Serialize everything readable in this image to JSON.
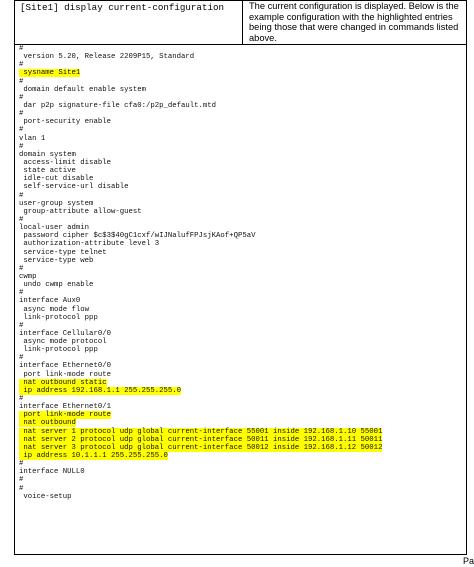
{
  "header": {
    "command": "[Site1] display current-configuration",
    "description": "The current configuration is displayed. Below is the example configuration with the highlighted entries being those that were changed in commands listed above."
  },
  "config_lines": [
    {
      "text": "#",
      "hl": false
    },
    {
      "text": " version 5.20, Release 2209P15, Standard",
      "hl": false
    },
    {
      "text": "#",
      "hl": false
    },
    {
      "text": " sysname Site1",
      "hl": true
    },
    {
      "text": "#",
      "hl": false
    },
    {
      "text": " domain default enable system",
      "hl": false
    },
    {
      "text": "#",
      "hl": false
    },
    {
      "text": " dar p2p signature-file cfa0:/p2p_default.mtd",
      "hl": false
    },
    {
      "text": "#",
      "hl": false
    },
    {
      "text": " port-security enable",
      "hl": false
    },
    {
      "text": "#",
      "hl": false
    },
    {
      "text": "vlan 1",
      "hl": false
    },
    {
      "text": "#",
      "hl": false
    },
    {
      "text": "domain system",
      "hl": false
    },
    {
      "text": " access-limit disable",
      "hl": false
    },
    {
      "text": " state active",
      "hl": false
    },
    {
      "text": " idle-cut disable",
      "hl": false
    },
    {
      "text": " self-service-url disable",
      "hl": false
    },
    {
      "text": "#",
      "hl": false
    },
    {
      "text": "user-group system",
      "hl": false
    },
    {
      "text": " group-attribute allow-guest",
      "hl": false
    },
    {
      "text": "#",
      "hl": false
    },
    {
      "text": "local-user admin",
      "hl": false
    },
    {
      "text": " password cipher $c$3$40gC1cxf/wIJNalufFPJsjKAof+QP5aV",
      "hl": false
    },
    {
      "text": " authorization-attribute level 3",
      "hl": false
    },
    {
      "text": " service-type telnet",
      "hl": false
    },
    {
      "text": " service-type web",
      "hl": false
    },
    {
      "text": "#",
      "hl": false
    },
    {
      "text": "cwmp",
      "hl": false
    },
    {
      "text": " undo cwmp enable",
      "hl": false
    },
    {
      "text": "#",
      "hl": false
    },
    {
      "text": "interface Aux0",
      "hl": false
    },
    {
      "text": " async mode flow",
      "hl": false
    },
    {
      "text": " link-protocol ppp",
      "hl": false
    },
    {
      "text": "#",
      "hl": false
    },
    {
      "text": "interface Cellular0/0",
      "hl": false
    },
    {
      "text": " async mode protocol",
      "hl": false
    },
    {
      "text": " link-protocol ppp",
      "hl": false
    },
    {
      "text": "#",
      "hl": false
    },
    {
      "text": "interface Ethernet0/0",
      "hl": false
    },
    {
      "text": " port link-mode route",
      "hl": false
    },
    {
      "text": " nat outbound static",
      "hl": true
    },
    {
      "text": " ip address 192.168.1.1 255.255.255.0",
      "hl": true
    },
    {
      "text": "#",
      "hl": false
    },
    {
      "text": "interface Ethernet0/1",
      "hl": false
    },
    {
      "text": " port link-mode route",
      "hl": true
    },
    {
      "text": " nat outbound",
      "hl": true
    },
    {
      "text": " nat server 1 protocol udp global current-interface 55001 inside 192.168.1.10 55001",
      "hl": true
    },
    {
      "text": " nat server 2 protocol udp global current-interface 50011 inside 192.168.1.11 50011",
      "hl": true
    },
    {
      "text": " nat server 3 protocol udp global current-interface 50012 inside 192.168.1.12 50012",
      "hl": true
    },
    {
      "text": " ip address 10.1.1.1 255.255.255.0",
      "hl": true
    },
    {
      "text": "#",
      "hl": false
    },
    {
      "text": "interface NULL0",
      "hl": false
    },
    {
      "text": "#",
      "hl": false
    },
    {
      "text": "#",
      "hl": false
    },
    {
      "text": " voice-setup",
      "hl": false
    }
  ],
  "footer": {
    "page_label": "Pa"
  },
  "colors": {
    "highlight": "#ffff00",
    "border": "#000000"
  }
}
